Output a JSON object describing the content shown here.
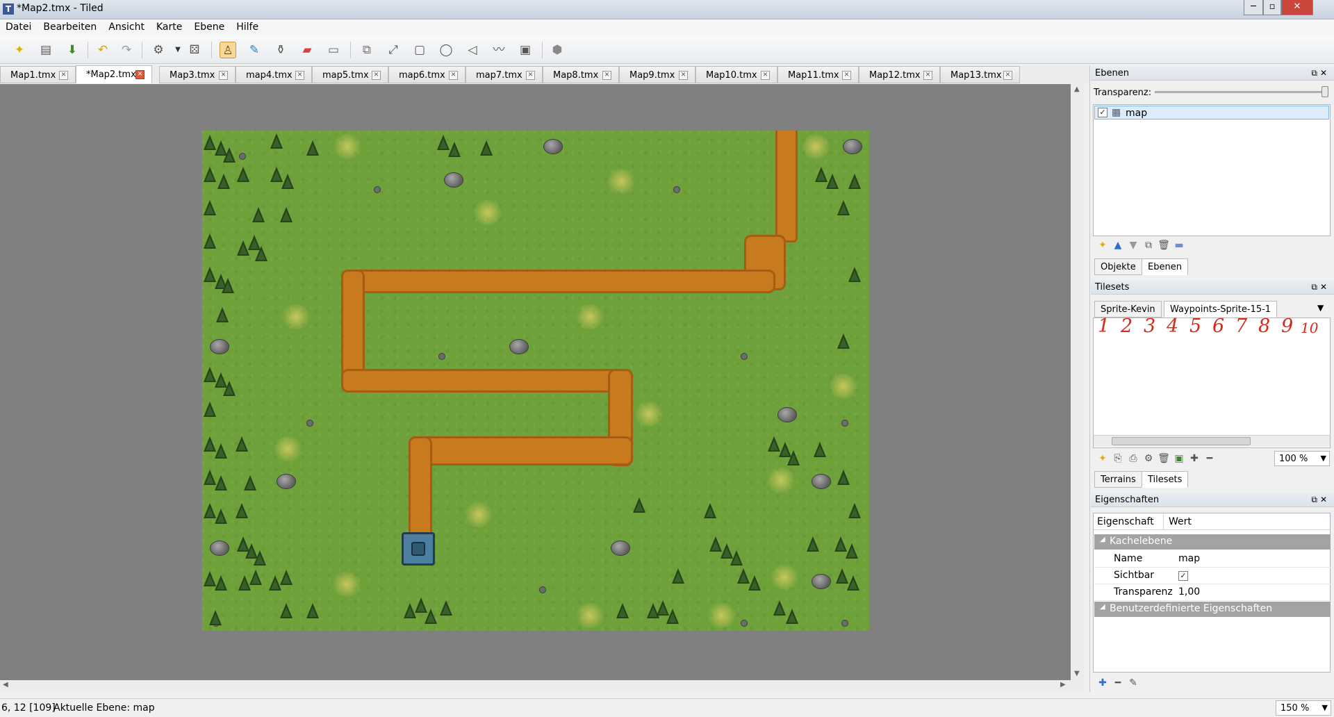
{
  "window": {
    "title": "*Map2.tmx - Tiled",
    "min_label": "─",
    "max_label": "▫",
    "close_label": "✕"
  },
  "menu": [
    "Datei",
    "Bearbeiten",
    "Ansicht",
    "Karte",
    "Ebene",
    "Hilfe"
  ],
  "tabs": [
    {
      "label": "Map1.tmx"
    },
    {
      "label": "*Map2.tmx",
      "active": true
    },
    {
      "label": "Map3.tmx"
    },
    {
      "label": "map4.tmx"
    },
    {
      "label": "map5.tmx"
    },
    {
      "label": "map6.tmx"
    },
    {
      "label": "map7.tmx"
    },
    {
      "label": "Map8.tmx"
    },
    {
      "label": "Map9.tmx"
    },
    {
      "label": "Map10.tmx"
    },
    {
      "label": "Map11.tmx"
    },
    {
      "label": "Map12.tmx"
    },
    {
      "label": "Map13.tmx"
    }
  ],
  "layers_panel": {
    "title": "Ebenen",
    "transparency_label": "Transparenz:",
    "layers": [
      {
        "name": "map",
        "visible": true
      }
    ],
    "tab_objects": "Objekte",
    "tab_layers": "Ebenen"
  },
  "tilesets_panel": {
    "title": "Tilesets",
    "tabs": [
      "Sprite-Kevin",
      "Waypoints-Sprite-15-1"
    ],
    "waypoints": [
      "1",
      "2",
      "3",
      "4",
      "5",
      "6",
      "7",
      "8",
      "9",
      "10"
    ],
    "zoom": "100 %",
    "tab_terrains": "Terrains",
    "tab_tilesets": "Tilesets"
  },
  "properties_panel": {
    "title": "Eigenschaften",
    "col_property": "Eigenschaft",
    "col_value": "Wert",
    "group_tile_layer": "Kachelebene",
    "rows": [
      {
        "key": "Name",
        "value": "map"
      },
      {
        "key": "Sichtbar",
        "value": "✓"
      },
      {
        "key": "Transparenz",
        "value": "1,00"
      }
    ],
    "group_custom": "Benutzerdefinierte Eigenschaften"
  },
  "status": {
    "position": "6, 12 [109]",
    "current_layer": "Aktuelle Ebene: map",
    "zoom": "150 %"
  },
  "colors": {
    "grass": "#6ea13a",
    "path": "#c77a1e",
    "canvas_bg": "#808080",
    "tower": "#4c7fa0"
  }
}
